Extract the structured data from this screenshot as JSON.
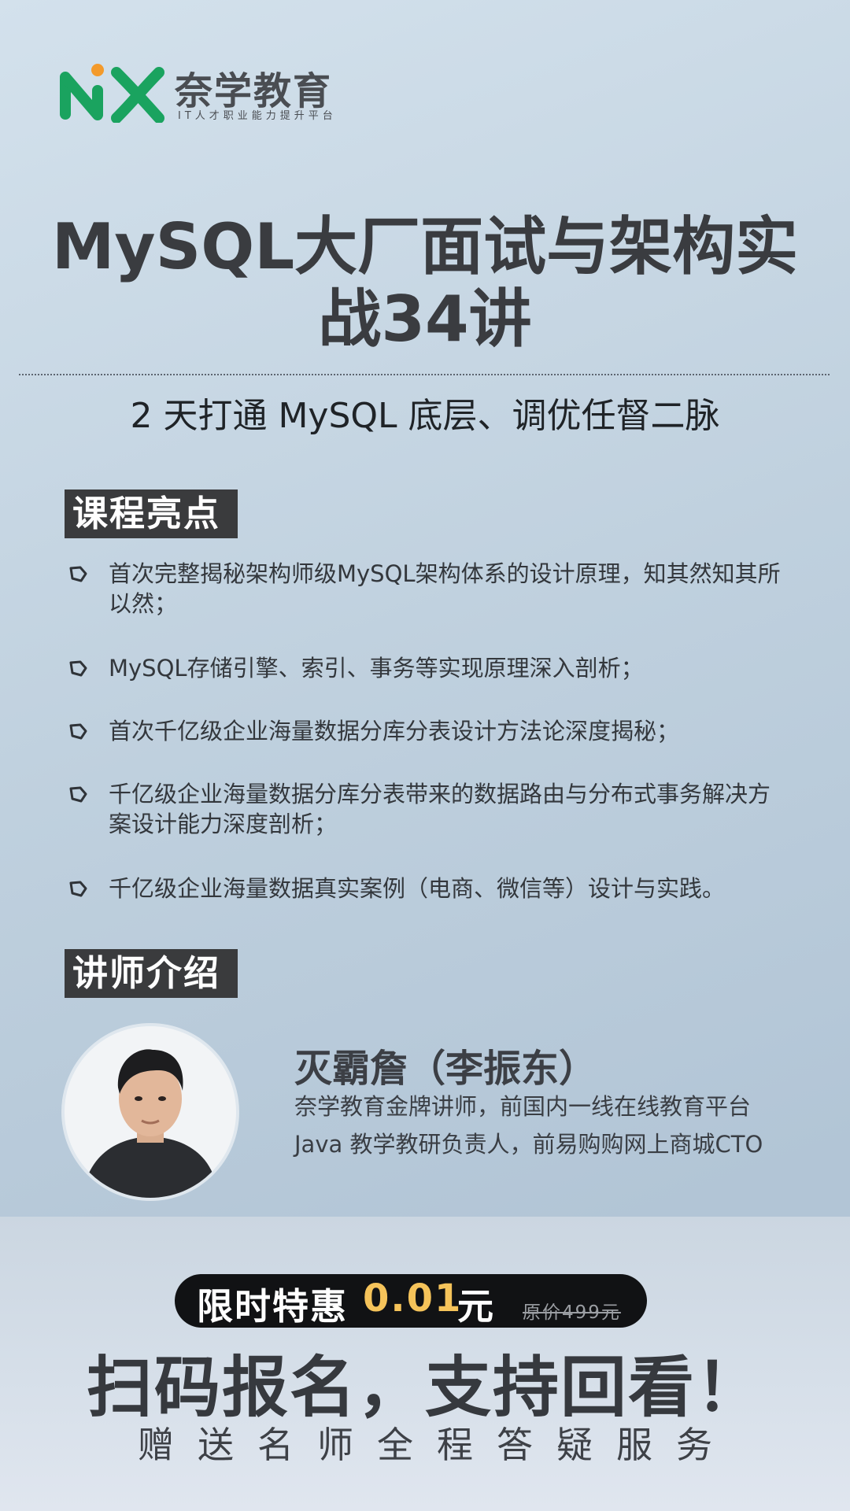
{
  "brand": {
    "name": "奈学教育",
    "slogan": "IT人才职业能力提升平台",
    "colors": {
      "green": "#1aa35f",
      "orange": "#f39a2b"
    },
    "icon": "nx-logo-icon"
  },
  "title": "MySQL大厂面试与架构实战34讲",
  "subtitle": "2 天打通 MySQL 底层、调优任督二脉",
  "highlights": {
    "heading": "课程亮点",
    "icon": "hexagon-bullet-icon",
    "items": [
      "首次完整揭秘架构师级MySQL架构体系的设计原理，知其然知其所以然；",
      "MySQL存储引擎、索引、事务等实现原理深入剖析；",
      "首次千亿级企业海量数据分库分表设计方法论深度揭秘；",
      "千亿级企业海量数据分库分表带来的数据路由与分布式事务解决方案设计能力深度剖析；",
      "千亿级企业海量数据真实案例（电商、微信等）设计与实践。"
    ]
  },
  "lecturer": {
    "heading": "讲师介绍",
    "name": "灭霸詹（李振东）",
    "description": "奈学教育金牌讲师，前国内一线在线教育平台 Java 教学教研负责人，前易购购网上商城CTO",
    "avatar_icon": "lecturer-avatar"
  },
  "promo": {
    "label": "限时特惠",
    "price": "0.01",
    "unit": "元",
    "original": "原价499元",
    "price_color": "#f5c35a",
    "cta": "扫码报名，支持回看！",
    "service": "赠送名师全程答疑服务"
  }
}
